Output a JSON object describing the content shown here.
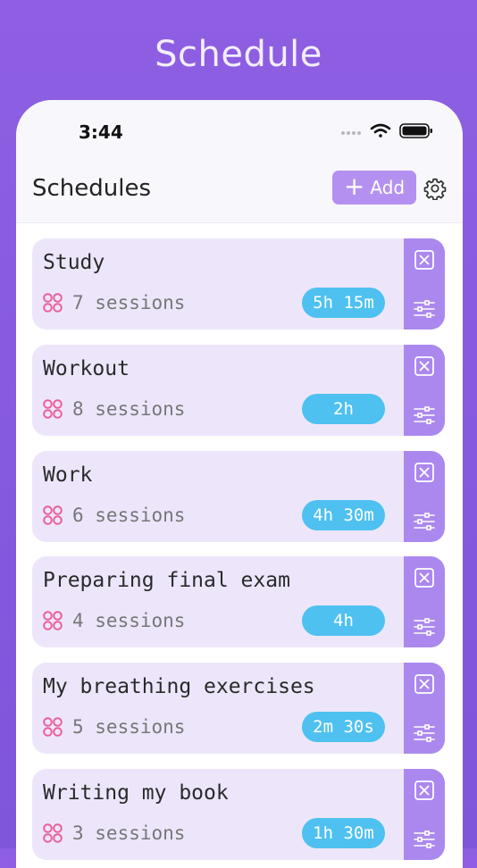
{
  "banner_title": "Schedule",
  "status": {
    "time": "3:44"
  },
  "nav": {
    "title": "Schedules",
    "add_label": "Add"
  },
  "colors": {
    "background": "#8e5fe2",
    "card": "#ede6fb",
    "side_column": "#ab88ee",
    "add_button": "#b491f0",
    "duration_pill": "#4ec1f0",
    "session_icon": "#e8609a"
  },
  "icons": {
    "add": "plus-icon",
    "settings": "gear-icon",
    "sessions": "four-circles-icon",
    "remove": "close-square-icon",
    "edit": "sliders-icon"
  },
  "schedules": [
    {
      "name": "Study",
      "sessions": "7 sessions",
      "duration": "5h 15m"
    },
    {
      "name": "Workout",
      "sessions": "8 sessions",
      "duration": "2h"
    },
    {
      "name": "Work",
      "sessions": "6 sessions",
      "duration": "4h 30m"
    },
    {
      "name": "Preparing final exam",
      "sessions": "4 sessions",
      "duration": "4h"
    },
    {
      "name": "My breathing exercises",
      "sessions": "5 sessions",
      "duration": "2m 30s"
    },
    {
      "name": "Writing my book",
      "sessions": "3 sessions",
      "duration": "1h 30m"
    }
  ]
}
